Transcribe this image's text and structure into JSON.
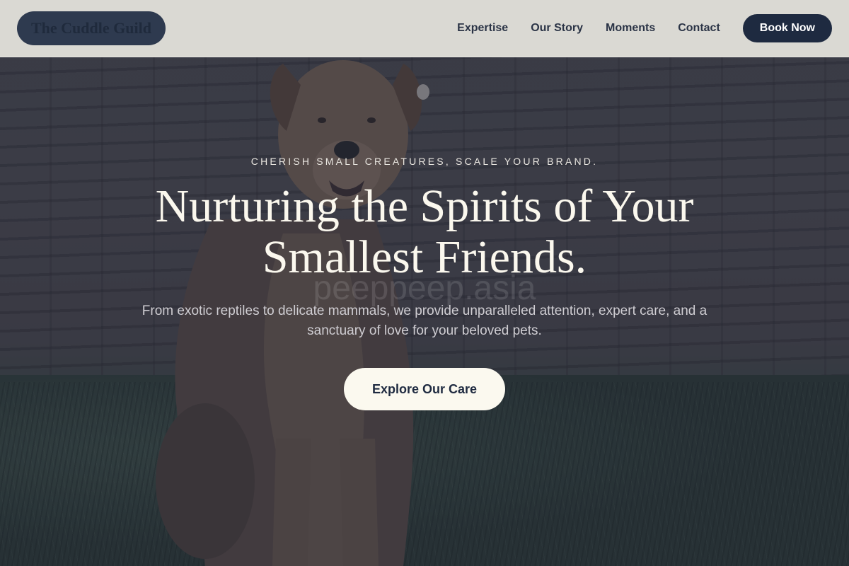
{
  "brand": {
    "name": "The Cuddle Guild"
  },
  "nav": {
    "links": [
      "Expertise",
      "Our Story",
      "Moments",
      "Contact"
    ],
    "cta_label": "Book Now"
  },
  "hero": {
    "eyebrow": "CHERISH SMALL CREATURES, SCALE YOUR BRAND.",
    "headline_line1": "Nurturing the Spirits of Your",
    "headline_line2": "Smallest Friends.",
    "watermark": "peeppeep.asia",
    "subtext": "From exotic reptiles to delicate mammals, we provide unparalleled attention, expert care, and a sanctuary of love for your beloved pets.",
    "cta_label": "Explore Our Care",
    "background_image": "dog-sitting-on-grass-photo"
  },
  "colors": {
    "accent_dark": "#1e2a40",
    "cream": "#fbf9ef",
    "header_bg": "#e4e3dc"
  }
}
